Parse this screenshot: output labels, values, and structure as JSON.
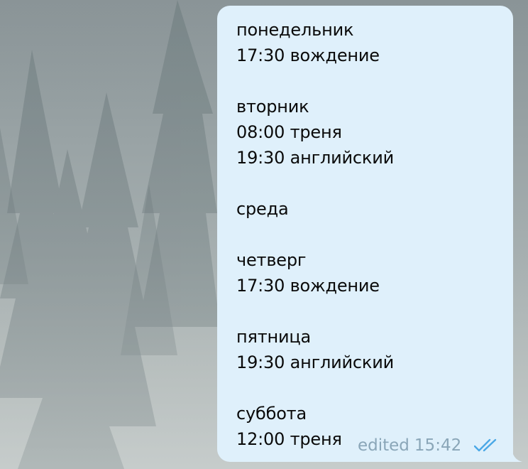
{
  "message": {
    "lines": [
      "понедельник",
      "17:30 вождение",
      "",
      "вторник",
      "08:00 треня",
      "19:30 английский",
      "",
      "среда",
      "",
      "четверг",
      "17:30 вождение",
      "",
      "пятница",
      "19:30 английский",
      "",
      "суббота",
      "12:00 треня"
    ],
    "edited_label": "edited",
    "time": "15:42",
    "status_icon": "double-check-icon"
  },
  "colors": {
    "bubble": "#dff0fb",
    "meta_text": "#8aa6b8",
    "check": "#4aa8e6",
    "text": "#0a0a0a"
  }
}
